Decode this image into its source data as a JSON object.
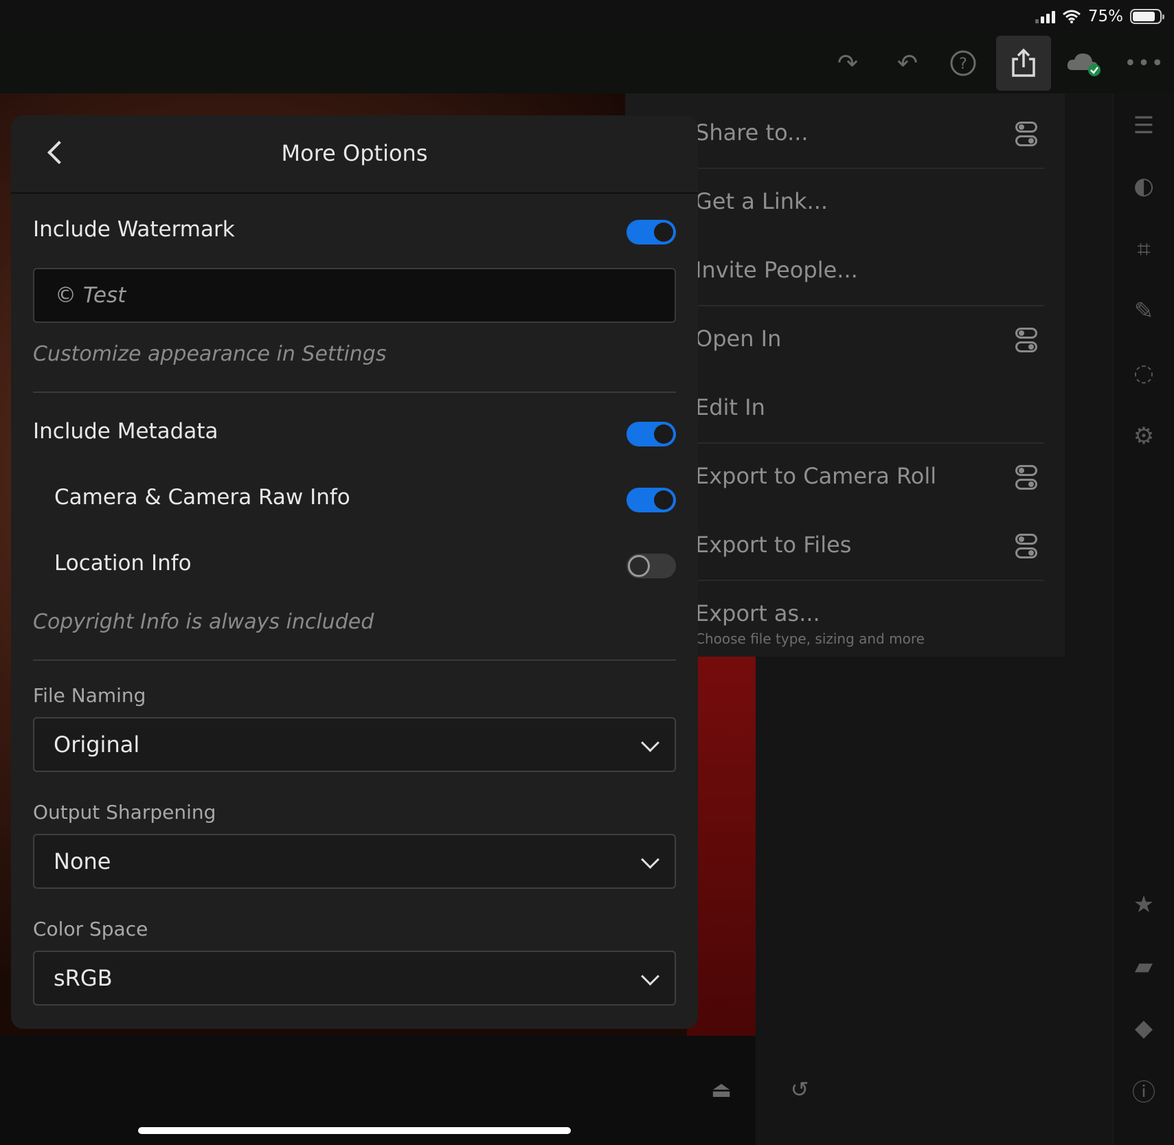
{
  "status": {
    "battery": "75%"
  },
  "share_menu": {
    "items": [
      {
        "label": "Share to..."
      },
      {
        "label": "Get a Link..."
      },
      {
        "label": "Invite People..."
      },
      {
        "label": "Open In"
      },
      {
        "label": "Edit In"
      },
      {
        "label": "Export to Camera Roll"
      },
      {
        "label": "Export to Files"
      },
      {
        "label": "Export as..."
      }
    ],
    "export_as_subtitle": "Choose file type, sizing and more"
  },
  "dialog": {
    "title": "More Options",
    "watermark": {
      "label": "Include Watermark",
      "enabled": true,
      "text_value": "© Test",
      "hint": "Customize appearance in Settings"
    },
    "metadata": {
      "label": "Include Metadata",
      "enabled": true,
      "camera_label": "Camera & Camera Raw Info",
      "camera_enabled": true,
      "location_label": "Location Info",
      "location_enabled": false,
      "hint": "Copyright Info is always included"
    },
    "file_naming": {
      "label": "File Naming",
      "value": "Original"
    },
    "output_sharpening": {
      "label": "Output Sharpening",
      "value": "None"
    },
    "color_space": {
      "label": "Color Space",
      "value": "sRGB"
    }
  }
}
